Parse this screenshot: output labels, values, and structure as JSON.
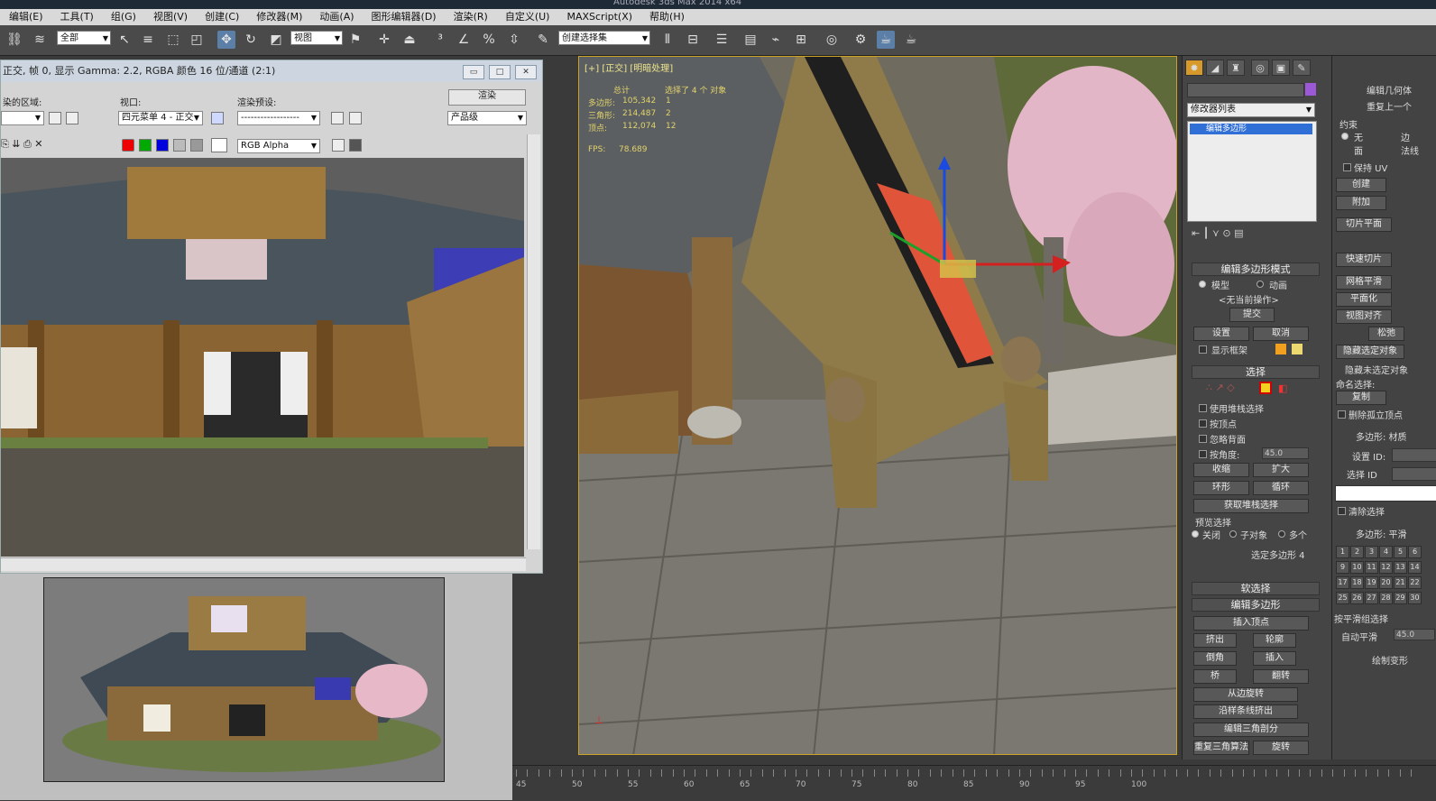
{
  "app": {
    "title": "Autodesk 3ds Max 2014 x64"
  },
  "menu": [
    "编辑(E)",
    "工具(T)",
    "组(G)",
    "视图(V)",
    "创建(C)",
    "修改器(M)",
    "动画(A)",
    "图形编辑器(D)",
    "渲染(R)",
    "自定义(U)",
    "MAXScript(X)",
    "帮助(H)"
  ],
  "toolbar": {
    "selection_filter": "全部",
    "ref_coord": "视图",
    "named_selection": "创建选择集"
  },
  "render_window": {
    "title": "正交, 帧 0, 显示 Gamma: 2.2, RGBA 颜色 16 位/通道 (2:1)",
    "area_label": "染的区域:",
    "viewport_label": "视口:",
    "preset_label": "渲染预设:",
    "render_button": "渲染",
    "viewport_value": "四元菜单 4 - 正交",
    "preset_value": "------------------",
    "production_value": "产品级",
    "channel_value": "RGB Alpha"
  },
  "viewport": {
    "label": "[+] [正交] [明暗处理]",
    "stats": {
      "total_label": "总计",
      "selected_label": "选择了 4 个 对象",
      "poly_label": "多边形:",
      "poly_value": "105,342",
      "poly_sel": "1",
      "tri_label": "三角形:",
      "tri_value": "214,487",
      "tri_sel": "2",
      "vert_label": "顶点:",
      "vert_value": "112,074",
      "vert_sel": "12",
      "fps_label": "FPS:",
      "fps_value": "78.689"
    }
  },
  "command_panel": {
    "modifier_list": "修改器列表",
    "stack_item": "编辑多边形",
    "edit_mode_section": "编辑多边形模式",
    "mode_model": "模型",
    "mode_anim": "动画",
    "no_op": "<无当前操作>",
    "commit": "提交",
    "settings": "设置",
    "cancel": "取消",
    "show_cage": "显示框架",
    "select_section": "选择",
    "use_stack": "使用堆栈选择",
    "by_vertex": "按顶点",
    "ignore_back": "忽略背面",
    "by_angle": "按角度:",
    "angle_value": "45.0",
    "shrink": "收缩",
    "grow": "扩大",
    "ring": "环形",
    "loop": "循环",
    "get_stack": "获取堆栈选择",
    "preview_section": "预览选择",
    "preview_off": "关闭",
    "preview_sub": "子对象",
    "preview_multi": "多个",
    "selected_count": "选定多边形 4",
    "soft_section": "软选择",
    "edit_poly_section": "编辑多边形",
    "insert_vertex": "插入顶点",
    "extrude": "挤出",
    "outline": "轮廓",
    "bevel": "倒角",
    "inset": "插入",
    "bridge": "桥",
    "flip": "翻转",
    "hinge": "从边旋转",
    "extrude_spline": "沿样条线挤出",
    "edit_tri": "编辑三角剖分",
    "retri": "重复三角算法",
    "turn": "旋转"
  },
  "right_panel": {
    "edit_geo": "编辑几何体",
    "repeat_last": "重复上一个",
    "constraint": "约束",
    "none": "无",
    "edge": "边",
    "face": "面",
    "normal": "法线",
    "preserve_uv": "保持 UV",
    "create": "创建",
    "attach": "附加",
    "slice_plane": "切片平面",
    "quick_slice": "快速切片",
    "meshsmooth": "网格平滑",
    "planarize": "平面化",
    "view_align": "视图对齐",
    "relax": "松弛",
    "hide_sel": "隐藏选定对象",
    "hide_unsel": "隐藏未选定对象",
    "named_sel": "命名选择:",
    "copy": "复制",
    "delete_iso": "删除孤立顶点",
    "poly_material": "多边形: 材质",
    "set_id": "设置 ID:",
    "select_id": "选择 ID",
    "clear_sel": "清除选择",
    "poly_smooth": "多边形: 平滑",
    "sel_by_smooth": "按平滑组选择",
    "auto_smooth": "自动平滑",
    "auto_value": "45.0",
    "paint_deform": "绘制变形",
    "smooth_groups": [
      "1",
      "2",
      "3",
      "4",
      "5",
      "6",
      "9",
      "10",
      "11",
      "12",
      "13",
      "14",
      "17",
      "18",
      "19",
      "20",
      "21",
      "22",
      "25",
      "26",
      "27",
      "28",
      "29",
      "30"
    ]
  },
  "timeline": {
    "ticks": [
      "45",
      "50",
      "55",
      "60",
      "65",
      "70",
      "75",
      "80",
      "85",
      "90",
      "95",
      "100"
    ]
  }
}
